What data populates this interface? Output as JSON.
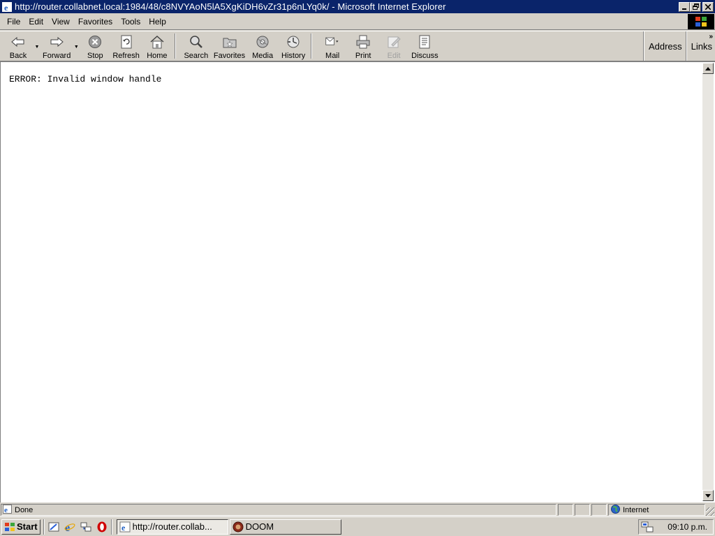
{
  "window": {
    "title": "http://router.collabnet.local:1984/48/c8NVYAoN5lA5XgKiDH6vZr31p6nLYq0k/ - Microsoft Internet Explorer"
  },
  "menu": [
    {
      "label": "File"
    },
    {
      "label": "Edit"
    },
    {
      "label": "View"
    },
    {
      "label": "Favorites"
    },
    {
      "label": "Tools"
    },
    {
      "label": "Help"
    }
  ],
  "toolbar": {
    "back": "Back",
    "forward": "Forward",
    "stop": "Stop",
    "refresh": "Refresh",
    "home": "Home",
    "search": "Search",
    "favorites": "Favorites",
    "media": "Media",
    "history": "History",
    "mail": "Mail",
    "print": "Print",
    "edit": "Edit",
    "discuss": "Discuss",
    "address": "Address",
    "links": "Links",
    "links_chevron": "»"
  },
  "content": {
    "text": "ERROR: Invalid window handle"
  },
  "status": {
    "text": "Done",
    "zone": "Internet"
  },
  "taskbar": {
    "start": "Start",
    "tasks": [
      {
        "label": "http://router.collab...",
        "active": true
      },
      {
        "label": "DOOM",
        "active": false
      }
    ],
    "clock": "09:10 p.m."
  },
  "icons": {
    "app": "ie-icon",
    "back": "back-arrow-icon",
    "forward": "forward-arrow-icon",
    "stop": "stop-icon",
    "refresh": "refresh-icon",
    "home": "home-icon",
    "search": "search-icon",
    "favorites": "favorites-icon",
    "media": "media-icon",
    "history": "history-icon",
    "mail": "mail-icon",
    "print": "print-icon",
    "edit": "edit-icon",
    "discuss": "discuss-icon"
  },
  "colors": {
    "titlebar": "#0a246a",
    "face": "#d4d0c8",
    "content_bg": "#ffffff"
  }
}
